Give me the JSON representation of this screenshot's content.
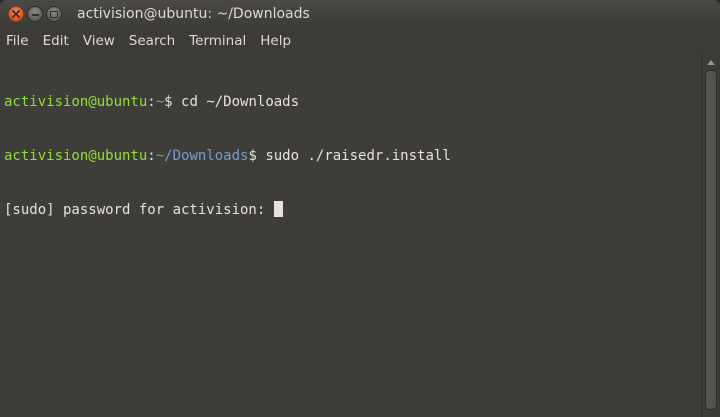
{
  "window": {
    "title": "activision@ubuntu: ~/Downloads",
    "buttons": {
      "close_icon": "close-icon",
      "minimize_icon": "minimize-icon",
      "maximize_icon": "maximize-icon"
    }
  },
  "menubar": {
    "items": [
      "File",
      "Edit",
      "View",
      "Search",
      "Terminal",
      "Help"
    ]
  },
  "terminal": {
    "lines": [
      {
        "user": "activision@ubuntu",
        "sep": ":",
        "path": "~",
        "prompt": "$ ",
        "command": "cd ~/Downloads"
      },
      {
        "user": "activision@ubuntu",
        "sep": ":",
        "path": "~/Downloads",
        "prompt": "$ ",
        "command": "sudo ./raisedr.install"
      },
      {
        "text": "[sudo] password for activision: "
      }
    ]
  },
  "colors": {
    "user": "#8ae234",
    "path": "#729fcf",
    "text": "#e6e3dc",
    "background": "#3e3d39",
    "close_button": "#e0531d"
  }
}
